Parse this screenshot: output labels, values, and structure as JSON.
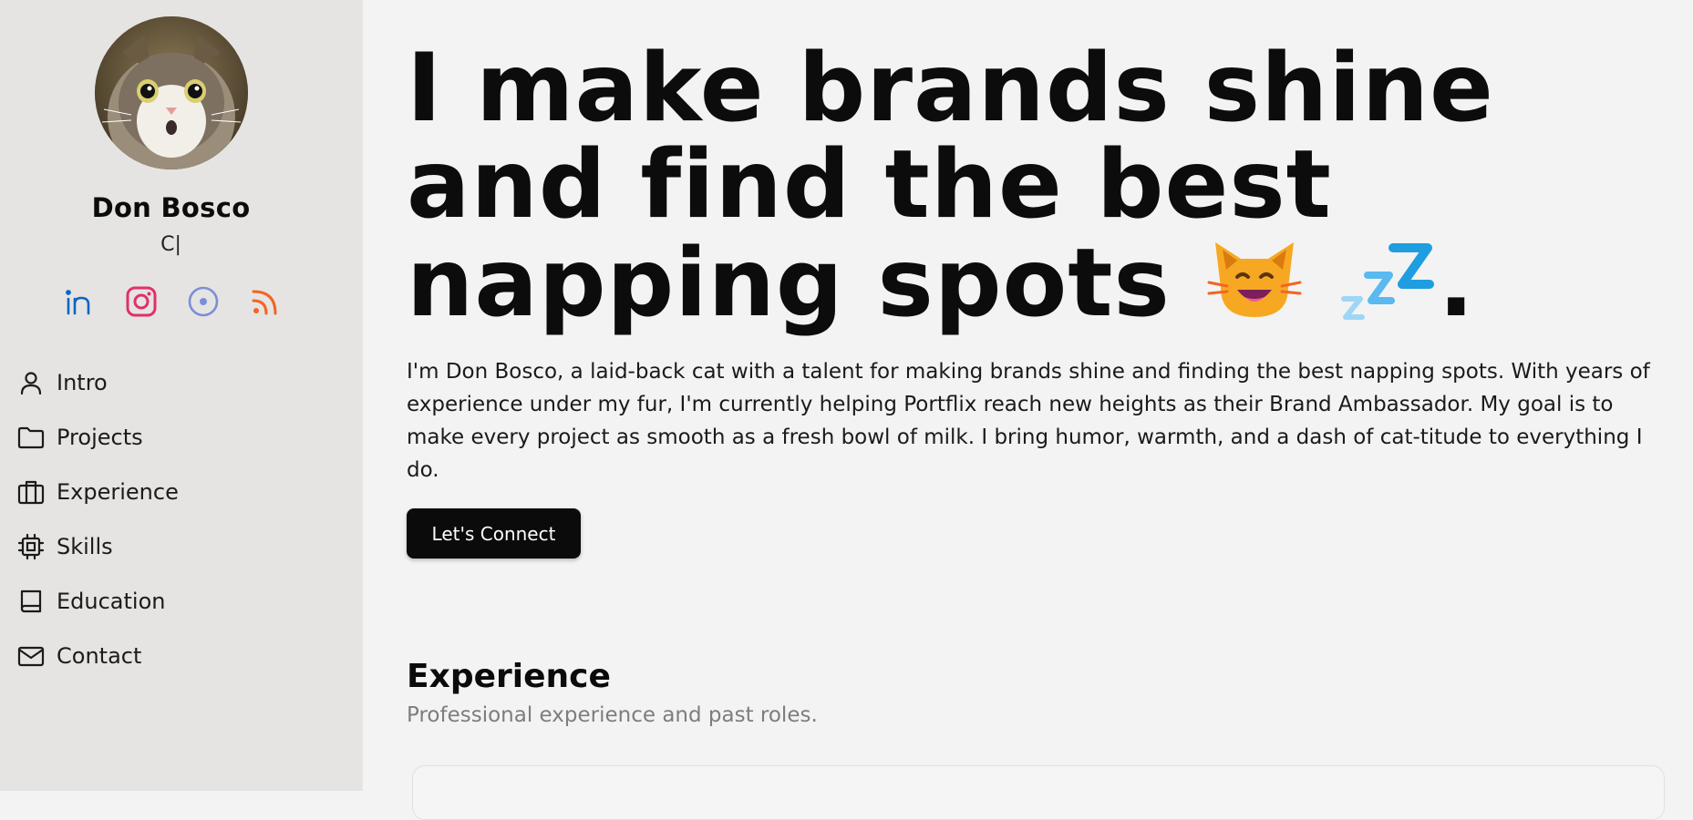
{
  "profile": {
    "name": "Don Bosco",
    "role": "C|"
  },
  "socials": [
    {
      "icon": "linkedin-icon",
      "color": "#0a66c2"
    },
    {
      "icon": "instagram-icon",
      "color": "#e1306c"
    },
    {
      "icon": "disc-icon",
      "color": "#7b8fd8"
    },
    {
      "icon": "rss-icon",
      "color": "#f26522"
    }
  ],
  "nav": {
    "items": [
      {
        "label": "Intro",
        "icon": "user-icon"
      },
      {
        "label": "Projects",
        "icon": "folder-icon"
      },
      {
        "label": "Experience",
        "icon": "briefcase-icon"
      },
      {
        "label": "Skills",
        "icon": "chip-icon"
      },
      {
        "label": "Education",
        "icon": "book-icon"
      },
      {
        "label": "Contact",
        "icon": "mail-icon"
      }
    ]
  },
  "hero": {
    "line1": "I make brands shine",
    "line2": "and find the best",
    "line3": "napping spots",
    "end": "."
  },
  "intro": "I'm Don Bosco, a laid-back cat with a talent for making brands shine and finding the best napping spots. With years of experience under my fur, I'm currently helping Portflix reach new heights as their Brand Ambassador. My goal is to make every project as smooth as a fresh bowl of milk. I bring humor, warmth, and a dash of cat-titude to everything I do.",
  "cta_label": "Let's Connect",
  "experience": {
    "title": "Experience",
    "subtitle": "Professional experience and past roles."
  }
}
